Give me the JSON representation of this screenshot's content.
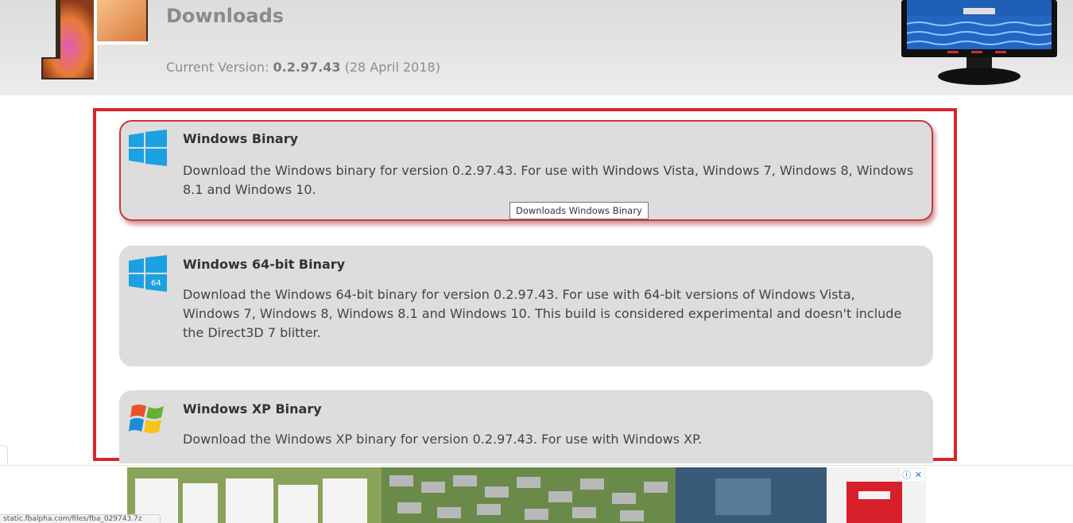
{
  "header": {
    "title": "Downloads",
    "version_label": "Current Version:",
    "version_number": "0.2.97.43",
    "version_date": "(28 April 2018)"
  },
  "downloads": [
    {
      "title": "Windows Binary",
      "description": "Download the Windows binary for version 0.2.97.43. For use with Windows Vista, Windows 7, Windows 8, Windows 8.1 and Windows 10.",
      "icon": "windows-icon"
    },
    {
      "title": "Windows 64-bit Binary",
      "description": "Download the Windows 64-bit binary for version 0.2.97.43. For use with 64-bit versions of Windows Vista, Windows 7, Windows 8, Windows 8.1 and Windows 10. This build is considered experimental and doesn't include the Direct3D 7 blitter.",
      "icon": "windows-64-icon",
      "icon_badge": "64"
    },
    {
      "title": "Windows XP Binary",
      "description": "Download the Windows XP binary for version 0.2.97.43. For use with Windows XP.",
      "icon": "windows-xp-icon"
    }
  ],
  "tooltip": "Downloads Windows Binary",
  "ad": {
    "info_icon": "ⓘ",
    "close_icon": "✕"
  },
  "status_bar": {
    "url": "static.fbalpha.com/files/fba_029743.7z"
  },
  "colors": {
    "highlight": "#d9252d",
    "card_background": "#dddddd",
    "windows_blue": "#1ba1e2"
  }
}
